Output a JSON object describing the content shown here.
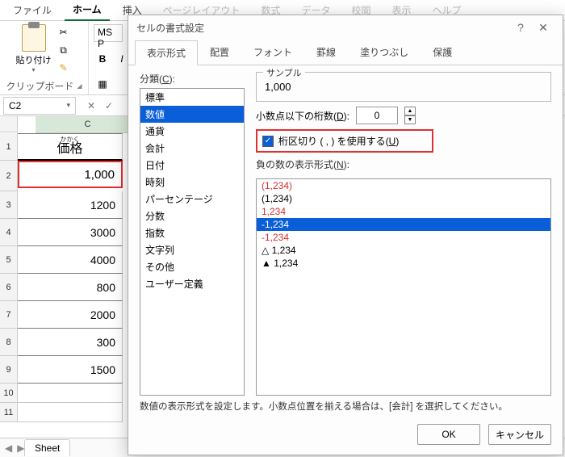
{
  "ribbon": {
    "tabs": [
      "ファイル",
      "ホーム",
      "挿入",
      "ページレイアウト",
      "数式",
      "データ",
      "校閲",
      "表示",
      "ヘルプ"
    ],
    "active_index": 1,
    "clipboard_group": "クリップボード",
    "paste_label": "貼り付け",
    "font_name_partial": "MS P"
  },
  "namebox": "C2",
  "grid": {
    "col_letter": "C",
    "header_cell": "価格",
    "header_ruby": "かかく",
    "rows": [
      "1,000",
      "1200",
      "3000",
      "4000",
      "800",
      "2000",
      "300",
      "1500"
    ],
    "sheet_tab": "Sheet"
  },
  "dialog": {
    "title": "セルの書式設定",
    "tabs": [
      "表示形式",
      "配置",
      "フォント",
      "罫線",
      "塗りつぶし",
      "保護"
    ],
    "active_tab": 0,
    "category_label_pre": "分類(",
    "category_label_key": "C",
    "category_label_post": "):",
    "categories": [
      "標準",
      "数値",
      "通貨",
      "会計",
      "日付",
      "時刻",
      "パーセンテージ",
      "分数",
      "指数",
      "文字列",
      "その他",
      "ユーザー定義"
    ],
    "category_selected": 1,
    "sample_label": "サンプル",
    "sample_value": "1,000",
    "decimals_label_pre": "小数点以下の桁数(",
    "decimals_label_key": "D",
    "decimals_label_post": "):",
    "decimals_value": "0",
    "thousands_label_pre": "桁区切り ( , ) を使用する(",
    "thousands_label_key": "U",
    "thousands_label_post": ")",
    "negative_label_pre": "負の数の表示形式(",
    "negative_label_key": "N",
    "negative_label_post": "):",
    "negatives": [
      {
        "text": "(1,234)",
        "red": true
      },
      {
        "text": "(1,234)",
        "red": false
      },
      {
        "text": "1,234",
        "red": true
      },
      {
        "text": "-1,234",
        "red": false,
        "selected": true
      },
      {
        "text": "-1,234",
        "red": true
      },
      {
        "text": "△ 1,234",
        "red": false
      },
      {
        "text": "▲ 1,234",
        "red": false
      }
    ],
    "description": "数値の表示形式を設定します。小数点位置を揃える場合は、[会計] を選択してください。",
    "ok": "OK",
    "cancel": "キャンセル"
  }
}
